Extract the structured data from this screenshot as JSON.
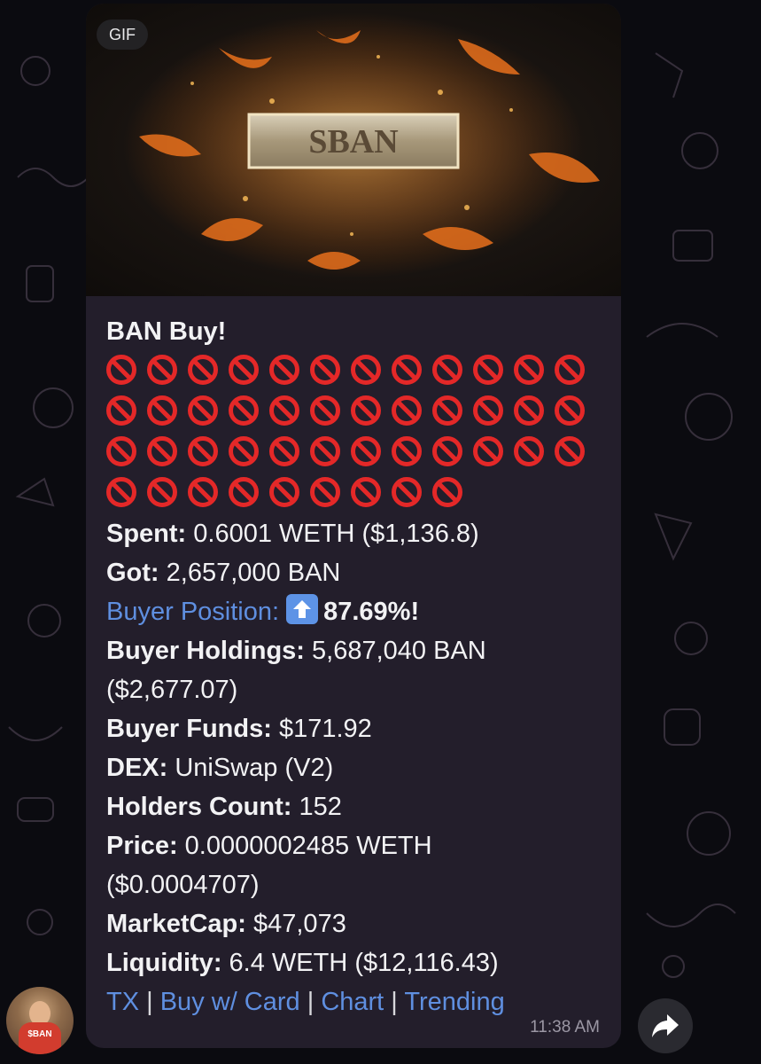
{
  "gif": {
    "badge": "GIF",
    "logo_text": "SBAN"
  },
  "message": {
    "title": "BAN Buy!",
    "emoji_rows": [
      12,
      12,
      12,
      9
    ],
    "spent": {
      "label": "Spent:",
      "value": " 0.6001 WETH ($1,136.8)"
    },
    "got": {
      "label": "Got:",
      "value": " 2,657,000 BAN"
    },
    "position": {
      "label": "Buyer Position:",
      "value": "87.69%!"
    },
    "holdings": {
      "label": "Buyer Holdings:",
      "value": " 5,687,040 BAN",
      "usd": "($2,677.07)"
    },
    "funds": {
      "label": "Buyer Funds:",
      "value": " $171.92"
    },
    "dex": {
      "label": "DEX:",
      "value": " UniSwap (V2)"
    },
    "holders": {
      "label": "Holders Count:",
      "value": " 152"
    },
    "price": {
      "label": "Price:",
      "value": " 0.0000002485 WETH",
      "usd": "($0.0004707)"
    },
    "marketcap": {
      "label": "MarketCap:",
      "value": " $47,073"
    },
    "liquidity": {
      "label": "Liquidity:",
      "value": " 6.4 WETH ($12,116.43)"
    },
    "links": {
      "tx": "TX",
      "sep": " | ",
      "buy_card": "Buy w/ Card",
      "chart": "Chart",
      "trending": "Trending"
    },
    "time": "11:38 AM"
  },
  "avatar": {
    "shirt_text": "$BAN"
  },
  "colors": {
    "bubble": "#231e2b",
    "link": "#5f8fe0",
    "noentry": "#e42828",
    "arrow_bg": "#5d93e6"
  }
}
